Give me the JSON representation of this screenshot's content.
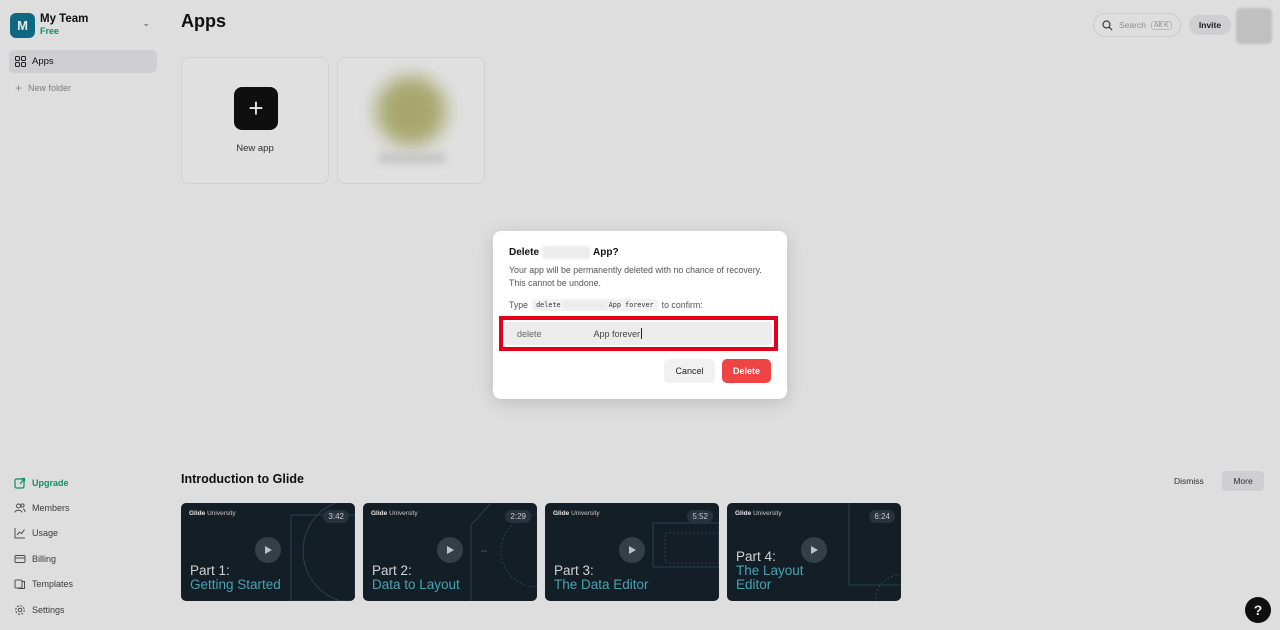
{
  "sidebar": {
    "team_initial": "M",
    "team_name": "My Team",
    "team_plan": "Free",
    "nav_apps": "Apps",
    "new_folder": "New folder",
    "bottom_items": {
      "upgrade": "Upgrade",
      "members": "Members",
      "usage": "Usage",
      "billing": "Billing",
      "templates": "Templates",
      "settings": "Settings"
    }
  },
  "header": {
    "title": "Apps",
    "search_placeholder": "Search",
    "search_shortcut": "Alt K",
    "invite_label": "Invite"
  },
  "apps": {
    "new_app_label": "New app"
  },
  "intro": {
    "title": "Introduction to Glide",
    "dismiss_label": "Dismiss",
    "more_label": "More",
    "videos": [
      {
        "brand": "Glide",
        "brand_sub": "University",
        "duration": "3:42",
        "part": "Part 1:",
        "name": "Getting Started"
      },
      {
        "brand": "Glide",
        "brand_sub": "University",
        "duration": "2:29",
        "part": "Part 2:",
        "name": "Data to Layout"
      },
      {
        "brand": "Glide",
        "brand_sub": "University",
        "duration": "5:52",
        "part": "Part 3:",
        "name": "The Data Editor"
      },
      {
        "brand": "Glide",
        "brand_sub": "University",
        "duration": "6:24",
        "part": "Part 4:",
        "name_line1": "The Layout",
        "name_line2": "Editor"
      }
    ]
  },
  "modal": {
    "title_prefix": "Delete",
    "title_suffix": "App?",
    "description": "Your app will be permanently deleted with no chance of recovery. This cannot be undone.",
    "confirm_prefix": "Type",
    "confirm_code_start": "delete",
    "confirm_code_end": "App forever",
    "confirm_suffix": "to confirm:",
    "input_value_start": "delete",
    "input_value_end": "App forever",
    "cancel_label": "Cancel",
    "delete_label": "Delete"
  },
  "help": {
    "label": "?"
  },
  "colors": {
    "accent_green": "#0e9f6e",
    "team_avatar": "#0e7490",
    "delete_red": "#ef4444",
    "highlight_red": "#e2001a",
    "video_bg": "#17212a",
    "video_title_accent": "#4fb3c8"
  }
}
